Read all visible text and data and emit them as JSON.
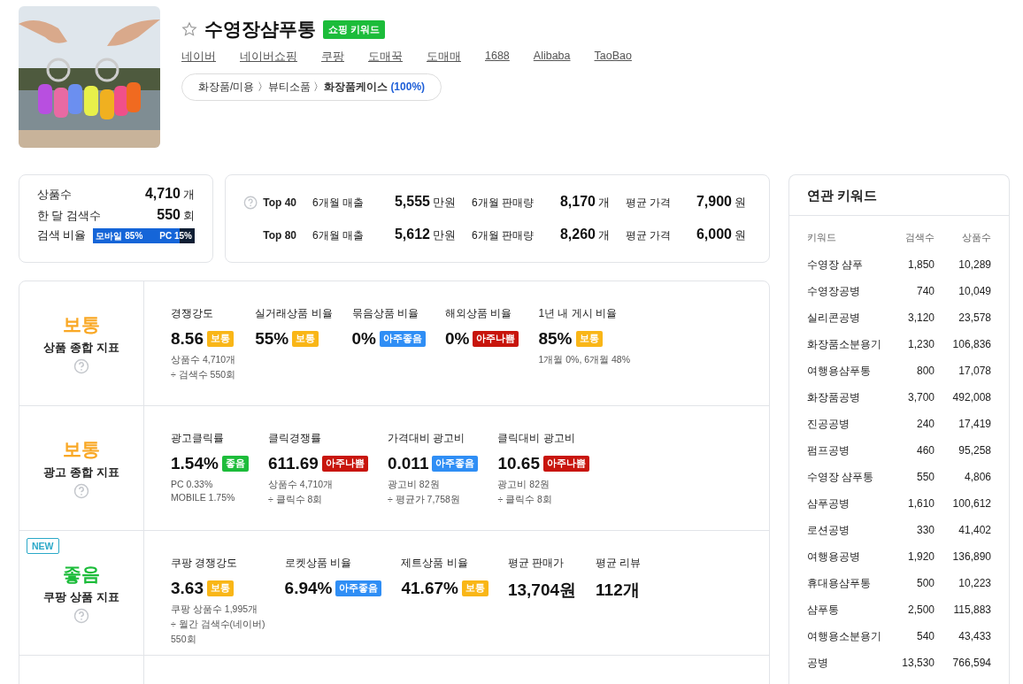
{
  "product": {
    "favorite": false,
    "title": "수영장샴푸통",
    "badge": "쇼핑 키워드",
    "links": [
      "네이버",
      "네이버쇼핑",
      "쿠팡",
      "도매꾹",
      "도매매",
      "1688",
      "Alibaba",
      "TaoBao"
    ],
    "category": {
      "path": [
        "화장품/미용",
        "뷰티소품"
      ],
      "separator": "〉",
      "leaf": "화장품케이스",
      "share": "(100%)"
    }
  },
  "overview": {
    "stats": [
      {
        "label": "상품수",
        "value": "4,710",
        "unit": "개"
      },
      {
        "label": "한 달 검색수",
        "value": "550",
        "unit": "회"
      }
    ],
    "search_ratio": {
      "label": "검색 비율",
      "mobile": "모바일 85%",
      "pc": "PC 15%",
      "level": 0.85
    }
  },
  "top": [
    {
      "rank": "Top 40",
      "help": true,
      "cells": [
        {
          "label": "6개월 매출",
          "value": "5,555",
          "unit": "만원"
        },
        {
          "label": "6개월 판매량",
          "value": "8,170",
          "unit": "개"
        },
        {
          "label": "평균 가격",
          "value": "7,900",
          "unit": "원"
        }
      ]
    },
    {
      "rank": "Top 80",
      "help": false,
      "cells": [
        {
          "label": "6개월 매출",
          "value": "5,612",
          "unit": "만원"
        },
        {
          "label": "6개월 판매량",
          "value": "8,260",
          "unit": "개"
        },
        {
          "label": "평균 가격",
          "value": "6,000",
          "unit": "원"
        }
      ]
    }
  ],
  "indicators": [
    {
      "grade": "보통",
      "color": "#f9a825",
      "title": "상품 종합 지표",
      "new": false,
      "metrics": [
        {
          "label": "경쟁강도",
          "value": "8.56",
          "badge": {
            "text": "보통",
            "kind": "normal"
          },
          "notes": [
            "상품수 4,710개",
            "÷ 검색수 550회"
          ]
        },
        {
          "label": "실거래상품 비율",
          "value": "55%",
          "badge": {
            "text": "보통",
            "kind": "normal"
          }
        },
        {
          "label": "묶음상품 비율",
          "value": "0%",
          "badge": {
            "text": "아주좋음",
            "kind": "very_good"
          }
        },
        {
          "label": "해외상품 비율",
          "value": "0%",
          "badge": {
            "text": "아주나쁨",
            "kind": "very_bad"
          }
        },
        {
          "label": "1년 내 게시 비율",
          "value": "85%",
          "badge": {
            "text": "보통",
            "kind": "normal"
          },
          "notes": [
            "1개월 0%, 6개월 48%"
          ]
        }
      ]
    },
    {
      "grade": "보통",
      "color": "#f9a825",
      "title": "광고 종합 지표",
      "new": false,
      "metrics": [
        {
          "label": "광고클릭률",
          "value": "1.54%",
          "badge": {
            "text": "좋음",
            "kind": "good"
          },
          "notes": [
            "PC 0.33%",
            "MOBILE 1.75%"
          ]
        },
        {
          "label": "클릭경쟁률",
          "value": "611.69",
          "badge": {
            "text": "아주나쁨",
            "kind": "very_bad"
          },
          "notes": [
            "상품수 4,710개",
            "÷ 클릭수 8회"
          ]
        },
        {
          "label": "가격대비 광고비",
          "value": "0.011",
          "badge": {
            "text": "아주좋음",
            "kind": "very_good"
          },
          "notes": [
            "광고비 82원",
            "÷ 평균가 7,758원"
          ]
        },
        {
          "label": "클릭대비 광고비",
          "value": "10.65",
          "badge": {
            "text": "아주나쁨",
            "kind": "very_bad"
          },
          "notes": [
            "광고비 82원",
            "÷ 클릭수 8회"
          ]
        }
      ]
    },
    {
      "grade": "좋음",
      "color": "#1cbc3a",
      "title": "쿠팡 상품 지표",
      "new": true,
      "new_label": "NEW",
      "metrics": [
        {
          "label": "쿠팡 경쟁강도",
          "value": "3.63",
          "badge": {
            "text": "보통",
            "kind": "normal"
          },
          "notes": [
            "쿠팡 상품수 1,995개",
            "÷ 월간 검색수(네이버)",
            "550회"
          ]
        },
        {
          "label": "로켓상품 비율",
          "value": "6.94%",
          "badge": {
            "text": "아주좋음",
            "kind": "very_good"
          }
        },
        {
          "label": "제트상품 비율",
          "value": "41.67%",
          "badge": {
            "text": "보통",
            "kind": "normal"
          }
        },
        {
          "label": "평균 판매가",
          "value": "13,704원"
        },
        {
          "label": "평균 리뷰",
          "value": "112개"
        }
      ]
    }
  ],
  "related": {
    "title": "연관 키워드",
    "columns": [
      "키워드",
      "검색수",
      "상품수"
    ],
    "rows": [
      [
        "수영장 샴푸",
        "1,850",
        "10,289"
      ],
      [
        "수영장공병",
        "740",
        "10,049"
      ],
      [
        "실리콘공병",
        "3,120",
        "23,578"
      ],
      [
        "화장품소분용기",
        "1,230",
        "106,836"
      ],
      [
        "여행용샴푸통",
        "800",
        "17,078"
      ],
      [
        "화장품공병",
        "3,700",
        "492,008"
      ],
      [
        "진공공병",
        "240",
        "17,419"
      ],
      [
        "펌프공병",
        "460",
        "95,258"
      ],
      [
        "수영장 샴푸통",
        "550",
        "4,806"
      ],
      [
        "샴푸공병",
        "1,610",
        "100,612"
      ],
      [
        "로션공병",
        "330",
        "41,402"
      ],
      [
        "여행용공병",
        "1,920",
        "136,890"
      ],
      [
        "휴대용샴푸통",
        "500",
        "10,223"
      ],
      [
        "샴푸통",
        "2,500",
        "115,883"
      ],
      [
        "여행용소분용기",
        "540",
        "43,433"
      ],
      [
        "공병",
        "13,530",
        "766,594"
      ]
    ]
  }
}
